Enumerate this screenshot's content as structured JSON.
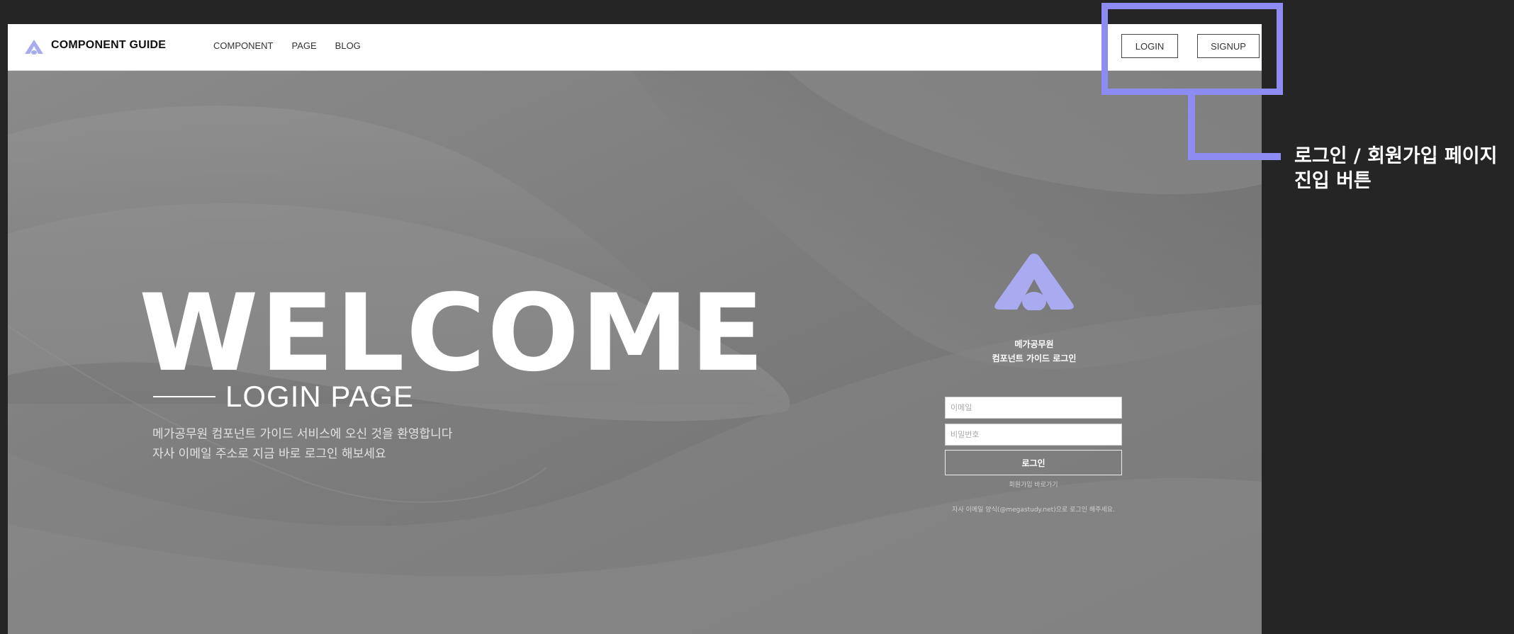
{
  "header": {
    "brand": "COMPONENT GUIDE",
    "nav": [
      {
        "label": "COMPONENT"
      },
      {
        "label": "PAGE"
      },
      {
        "label": "BLOG"
      }
    ],
    "login_label": "LOGIN",
    "signup_label": "SIGNUP"
  },
  "hero": {
    "headline": "WELCOME",
    "subheadline": "LOGIN PAGE",
    "intro_line1": "메가공무원 컴포넌트 가이드 서비스에 오신 것을 환영합니다",
    "intro_line2": "자사 이메일 주소로 지금 바로 로그인 해보세요"
  },
  "login_form": {
    "title_line1": "메가공무원",
    "title_line2": "컴포넌트 가이드 로그인",
    "email_placeholder": "이메일",
    "password_placeholder": "비밀번호",
    "submit_label": "로그인",
    "signup_link": "회원가입 바로가기",
    "note": "자사 이메일 양식(@megastudy.net)으로 로그인 해주세요."
  },
  "annotation": {
    "line1": "로그인 / 회원가입 페이지",
    "line2": "진입 버튼"
  },
  "colors": {
    "accent": "#8c8cf3",
    "logo": "#a9aaf0",
    "page_bg": "#252525",
    "hero_bg": "#7b7b7b"
  }
}
